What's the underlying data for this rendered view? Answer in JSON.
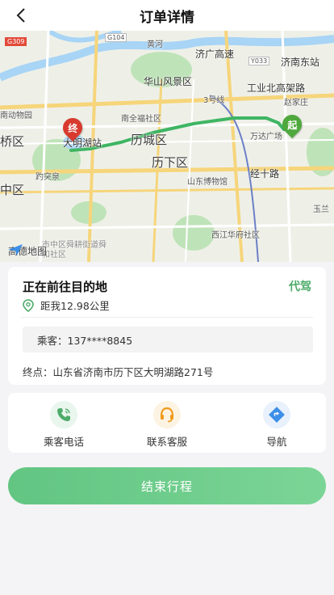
{
  "header": {
    "title": "订单详情"
  },
  "map": {
    "labels": {
      "jinan_east": "济南东站",
      "jiguang": "济广高速",
      "huashan": "华山风景区",
      "gongye": "工业北高架路",
      "zhaojia": "赵家庄",
      "zoo": "南动物园",
      "quanfu": "南全福社区",
      "lichengqu": "历城区",
      "daming_station": "大明湖站",
      "qiao": "桥区",
      "baotu": "趵突泉",
      "lixia": "历下区",
      "wanda": "万达广场",
      "museum": "山东博物馆",
      "jingshi": "经十路",
      "zhong": "中区",
      "yulan": "玉兰",
      "xijiang": "西江华府社区",
      "shunhe": "市中区舜耕街道舜和社区",
      "huanghe": "黄河",
      "line3": "3号线",
      "g309": "G309",
      "g104": "G104",
      "y033": "Y033",
      "logo": "高德地图"
    },
    "pin_end": "终",
    "pin_start": "起",
    "colors": {
      "route": "#3fb563",
      "pin_end": "#d83b2e",
      "pin_start": "#4fa83b",
      "water": "#a8d4f5",
      "park": "#bfe3b8"
    }
  },
  "info": {
    "status": "正在前往目的地",
    "service_type": "代驾",
    "distance": "距我12.98公里",
    "passenger": "乘客：137****8845",
    "destination": "终点：山东省济南市历下区大明湖路271号"
  },
  "actions": [
    {
      "label": "乘客电话",
      "icon": "phone-icon",
      "color": "#4dac6a"
    },
    {
      "label": "联系客服",
      "icon": "headset-icon",
      "color": "#f19a1a"
    },
    {
      "label": "导航",
      "icon": "navigation-icon",
      "color": "#3d8fe8"
    }
  ],
  "end_button": "结束行程"
}
